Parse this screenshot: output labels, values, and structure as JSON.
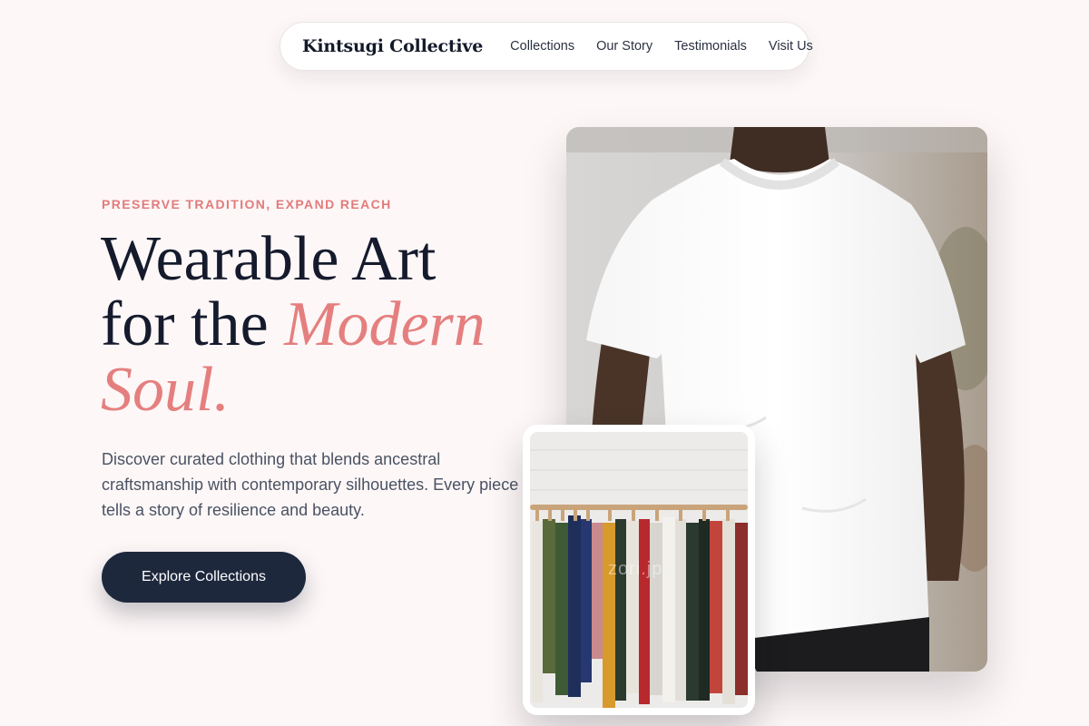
{
  "nav": {
    "brand": "Kintsugi Collective",
    "links": [
      "Collections",
      "Our Story",
      "Testimonials",
      "Visit Us"
    ]
  },
  "hero": {
    "eyebrow": "PRESERVE TRADITION, EXPAND REACH",
    "headline_line1": "Wearable Art",
    "headline_line2_plain": "for the ",
    "headline_line2_accent": "Modern",
    "headline_line3_accent": "Soul.",
    "description": "Discover curated clothing that blends ancestral craftsmanship with contemporary silhouettes. Every piece tells a story of resilience and beauty.",
    "cta_label": "Explore Collections"
  },
  "images": {
    "main_alt": "Person wearing a white t-shirt",
    "main_watermark": "zori.jp",
    "secondary_alt": "Rack of colorful clothes on hangers",
    "secondary_watermark": "zori.jp"
  },
  "colors": {
    "background": "#fdf7f7",
    "accent": "#e57f7f",
    "eyebrow": "#e27b7b",
    "dark": "#1e283d",
    "heading": "#151b2d"
  }
}
